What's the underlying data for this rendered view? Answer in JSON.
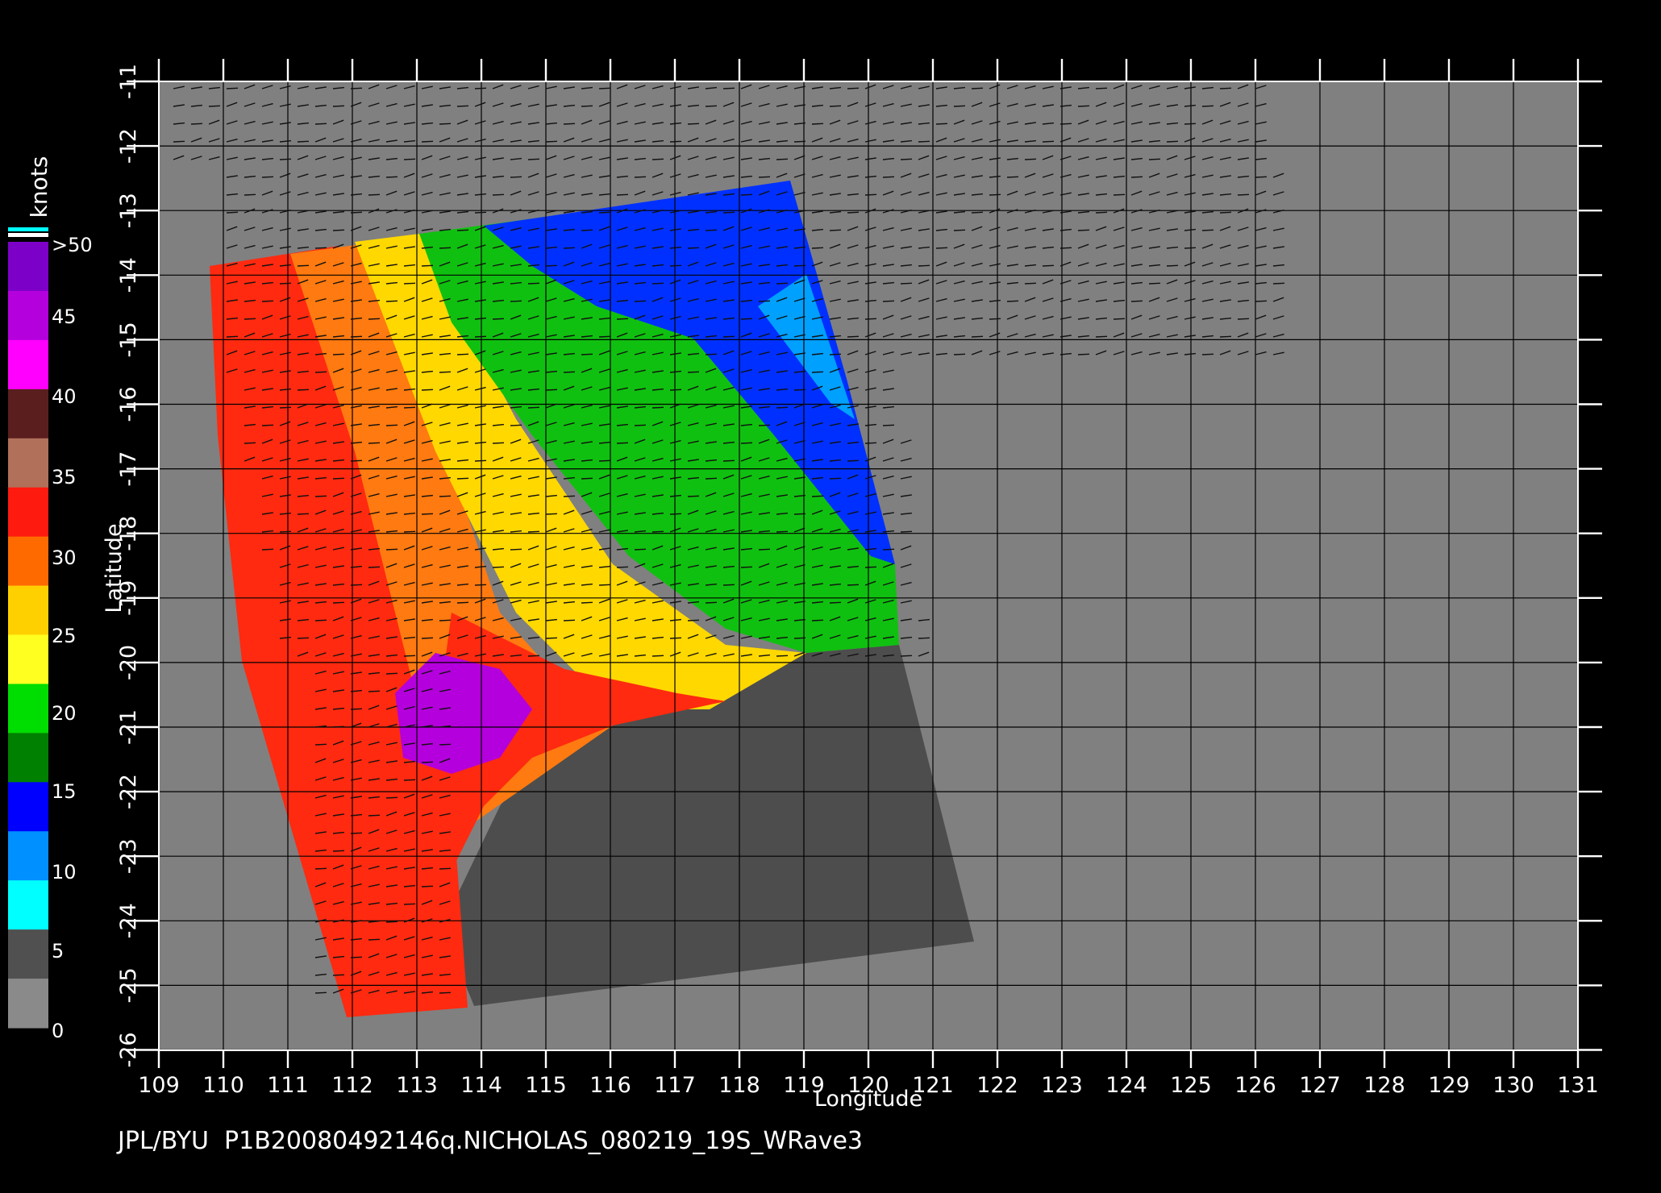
{
  "footer": "JPL/BYU  P1B20080492146q.NICHOLAS_080219_19S_WRave3",
  "legend": {
    "unit": "knots",
    "labels": [
      ">50",
      "45",
      "40",
      "35",
      "30",
      "25",
      "20",
      "15",
      "10",
      "5",
      "0"
    ],
    "colors": [
      "#7d00c8",
      "#b400dc",
      "#ff00ff",
      "#5a1e1e",
      "#b0705a",
      "#ff1a10",
      "#ff6a00",
      "#ffd000",
      "#ffff20",
      "#00dd00",
      "#008000",
      "#0000ff",
      "#0090ff",
      "#00ffff",
      "#505050",
      "#8a8a8a"
    ]
  },
  "axes": {
    "xlabel": "Longitude",
    "ylabel": "Latitude",
    "lon_ticks": [
      "109",
      "110",
      "111",
      "112",
      "113",
      "114",
      "115",
      "116",
      "117",
      "118",
      "119",
      "120",
      "121",
      "122",
      "123",
      "124",
      "125",
      "126",
      "127",
      "128",
      "129",
      "130",
      "131"
    ],
    "lat_ticks": [
      "-11",
      "-12",
      "-13",
      "-14",
      "-15",
      "-16",
      "-17",
      "-18",
      "-19",
      "-20",
      "-21",
      "-22",
      "-23",
      "-24",
      "-25",
      "-26"
    ]
  },
  "background_color": "#808080",
  "land_mask_color": "#4d4d4d",
  "storm": {
    "name": "NICHOLAS",
    "max_wind_class": ">50"
  }
}
